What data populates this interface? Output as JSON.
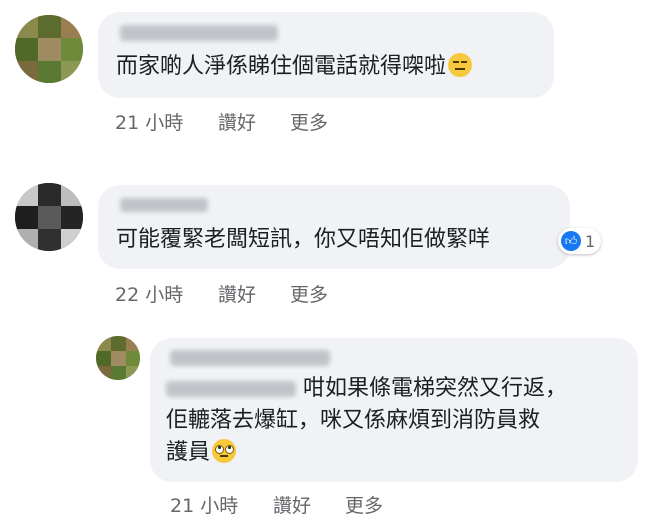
{
  "comments": [
    {
      "text": "而家啲人淨係睇住個電話就得㗎啦",
      "emoji": "expressionless-emoji",
      "actions": {
        "time": "21 小時",
        "like": "讚好",
        "more": "更多"
      }
    },
    {
      "text": "可能覆緊老闆短訊，你又唔知佢做緊咩",
      "reaction": {
        "icon": "like-icon",
        "count": "1"
      },
      "actions": {
        "time": "22 小時",
        "like": "讚好",
        "more": "更多"
      }
    },
    {
      "line1": "咁如果條電梯突然又行返，",
      "line2": "佢轆落去爆缸，咪又係麻煩到消防員救",
      "line3": "護員",
      "emoji": "eye-roll-emoji",
      "actions": {
        "time": "21 小時",
        "like": "讚好",
        "more": "更多"
      }
    }
  ],
  "colors": {
    "bubble": "#f0f2f5",
    "meta": "#65676b",
    "text": "#1c1e21",
    "like": "#1877f2"
  }
}
